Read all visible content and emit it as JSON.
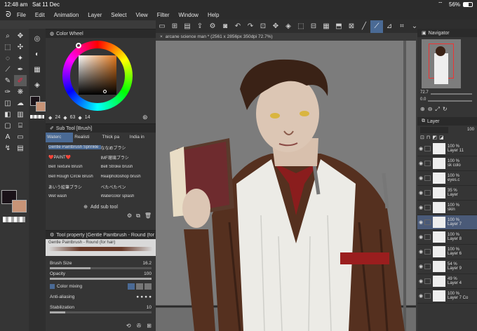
{
  "status": {
    "time": "12:48 am",
    "date": "Sat 11 Dec",
    "battery": "56%"
  },
  "menu": [
    "File",
    "Edit",
    "Animation",
    "Layer",
    "Select",
    "View",
    "Filter",
    "Window",
    "Help"
  ],
  "colorwheel": {
    "title": "Color Wheel",
    "v1": "24",
    "v2": "63",
    "v3": "14"
  },
  "subtool": {
    "title": "Sub Tool [Brush]",
    "tabs": [
      "Waterc",
      "Realisti",
      "Thick pa",
      "India in"
    ],
    "brushes": [
      [
        "Gentle Paintbrush Sprinkle",
        "ななめブラシ"
      ],
      [
        "❤️PAINT❤️",
        "IMF瑠璃ブラシ"
      ],
      [
        "Bell Texture Brush",
        "Bell Stroke brush"
      ],
      [
        "Bell Rough Circle Brush",
        "Realphotoshop brush"
      ],
      [
        "あいう絵筆ブラシ",
        "べたべたペン"
      ],
      [
        "Wet wash",
        "Watercolor splash"
      ]
    ],
    "add": "Add sub tool"
  },
  "toolprop": {
    "title": "Tool property [Gentle Paintbrush - Round (for h",
    "preset": "Gentle Paintbrush - Round (for hair)",
    "brush_size_label": "Brush Size",
    "brush_size": "16.2",
    "opacity_label": "Opacity",
    "opacity": "100",
    "color_mixing": "Color mixing",
    "antialias": "Anti-aliasing",
    "stabilization_label": "Stabilization",
    "stabilization": "10"
  },
  "canvas": {
    "tab": "arcane science man * (2561 x 2856px 350dpi 72.7%)"
  },
  "navigator": {
    "title": "Navigator",
    "zoom": "72.7",
    "angle": "0.0"
  },
  "layer": {
    "title": "Layer",
    "opacity": "100",
    "rows": [
      {
        "pct": "100 %",
        "name": "Layer 11"
      },
      {
        "pct": "100 %",
        "name": "sk colo"
      },
      {
        "pct": "100 %",
        "name": "eyes.c"
      },
      {
        "pct": "35 %",
        "name": "Layer"
      },
      {
        "pct": "100 %",
        "name": "skin"
      },
      {
        "pct": "100 %",
        "name": "Layer 7"
      },
      {
        "pct": "100 %",
        "name": "Layer 8"
      },
      {
        "pct": "100 %",
        "name": "Layer 6"
      },
      {
        "pct": "54 %",
        "name": "Layer 9"
      },
      {
        "pct": "49 %",
        "name": "Layer 4"
      },
      {
        "pct": "100 %",
        "name": "Layer 7 Co"
      }
    ]
  }
}
